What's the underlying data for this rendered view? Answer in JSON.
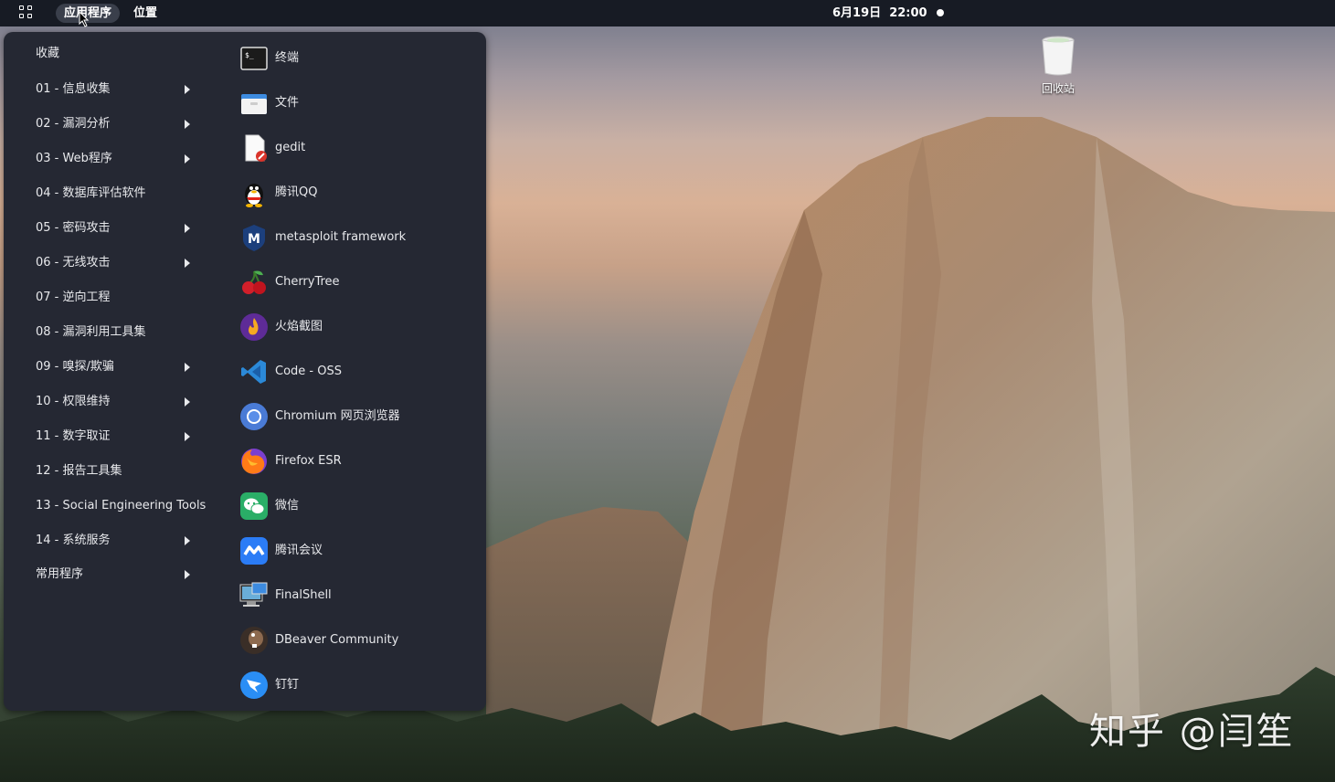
{
  "topbar": {
    "activities_icon": "grid-icon",
    "applications_label": "应用程序",
    "places_label": "位置",
    "clock": "6月19日  22:00"
  },
  "menu": {
    "categories": [
      {
        "label": "收藏",
        "submenu": false
      },
      {
        "label": "01 - 信息收集",
        "submenu": true
      },
      {
        "label": "02 - 漏洞分析",
        "submenu": true
      },
      {
        "label": "03 - Web程序",
        "submenu": true
      },
      {
        "label": "04 - 数据库评估软件",
        "submenu": false
      },
      {
        "label": "05 - 密码攻击",
        "submenu": true
      },
      {
        "label": "06 - 无线攻击",
        "submenu": true
      },
      {
        "label": "07 - 逆向工程",
        "submenu": false
      },
      {
        "label": "08 - 漏洞利用工具集",
        "submenu": false
      },
      {
        "label": "09 - 嗅探/欺骗",
        "submenu": true
      },
      {
        "label": "10 - 权限维持",
        "submenu": true
      },
      {
        "label": "11 - 数字取证",
        "submenu": true
      },
      {
        "label": "12 - 报告工具集",
        "submenu": false
      },
      {
        "label": "13 - Social Engineering Tools",
        "submenu": false
      },
      {
        "label": "14 - 系统服务",
        "submenu": true
      },
      {
        "label": "常用程序",
        "submenu": true
      }
    ],
    "apps": [
      {
        "label": "终端",
        "icon": "terminal-icon"
      },
      {
        "label": "文件",
        "icon": "folder-icon"
      },
      {
        "label": "gedit",
        "icon": "text-editor-icon"
      },
      {
        "label": "腾讯QQ",
        "icon": "qq-penguin-icon"
      },
      {
        "label": "metasploit framework",
        "icon": "metasploit-icon"
      },
      {
        "label": "CherryTree",
        "icon": "cherry-icon"
      },
      {
        "label": "火焰截图",
        "icon": "flameshot-icon"
      },
      {
        "label": "Code - OSS",
        "icon": "vscode-icon"
      },
      {
        "label": "Chromium 网页浏览器",
        "icon": "chromium-icon"
      },
      {
        "label": "Firefox ESR",
        "icon": "firefox-icon"
      },
      {
        "label": "微信",
        "icon": "wechat-icon"
      },
      {
        "label": "腾讯会议",
        "icon": "tencent-meeting-icon"
      },
      {
        "label": "FinalShell",
        "icon": "finalshell-icon"
      },
      {
        "label": "DBeaver Community",
        "icon": "dbeaver-icon"
      },
      {
        "label": "钉钉",
        "icon": "dingtalk-icon"
      }
    ]
  },
  "desktop": {
    "trash_label": "回收站",
    "watermark": "知乎 @闫笙"
  },
  "colors": {
    "topbar_bg": "#171b24",
    "menu_bg": "#252833",
    "menu_text": "#e8e9ec"
  }
}
